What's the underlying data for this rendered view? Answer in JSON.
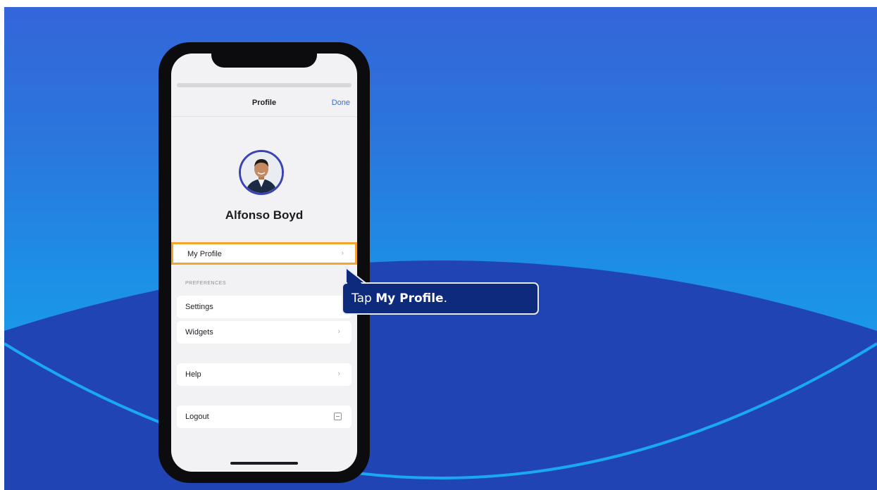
{
  "screen": {
    "title": "Profile",
    "done_label": "Done",
    "user_name": "Alfonso Boyd",
    "highlighted_row": "My Profile",
    "rows": {
      "my_profile": "My Profile",
      "section_preferences": "PREFERENCES",
      "settings": "Settings",
      "widgets": "Widgets",
      "help": "Help",
      "logout": "Logout"
    },
    "chevron": "›"
  },
  "callout": {
    "prefix": "Tap ",
    "bold": "My Profile",
    "suffix": "."
  },
  "colors": {
    "highlight": "#f2a42b",
    "callout_bg": "#0d2a7c",
    "accent_link": "#2f6ee0",
    "avatar_ring": "#3a42b8"
  },
  "icons": [
    "chevron-right-icon",
    "logout-icon",
    "avatar-photo"
  ]
}
